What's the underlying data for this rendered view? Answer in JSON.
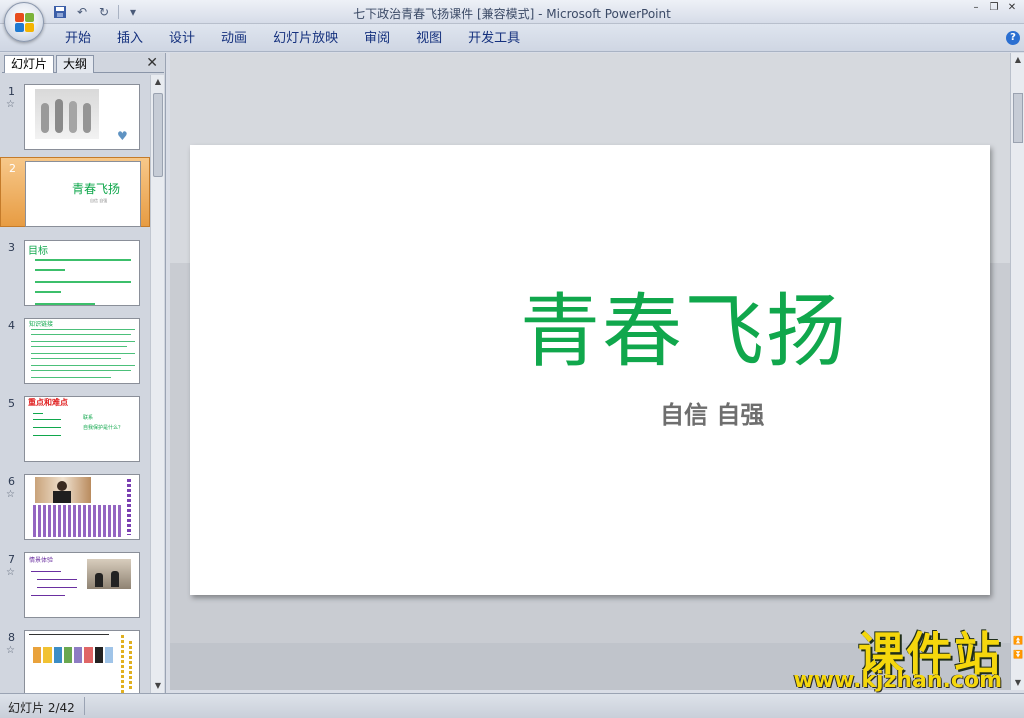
{
  "window": {
    "title": "七下政治青春飞扬课件 [兼容模式] - Microsoft PowerPoint"
  },
  "ribbon": {
    "tabs": [
      "开始",
      "插入",
      "设计",
      "动画",
      "幻灯片放映",
      "审阅",
      "视图",
      "开发工具"
    ]
  },
  "panel": {
    "tab_slides": "幻灯片",
    "tab_outline": "大纲",
    "close_glyph": "✕"
  },
  "thumbnails": [
    {
      "num": "1",
      "star": "☆"
    },
    {
      "num": "2",
      "title": "青春飞扬",
      "subtitle": "自信 自强"
    },
    {
      "num": "3",
      "title": "目标"
    },
    {
      "num": "4",
      "title": "知识链接"
    },
    {
      "num": "5",
      "title": "重点和难点",
      "lines": [
        "联系",
        "自我保护是什么？"
      ]
    },
    {
      "num": "6",
      "star": "☆"
    },
    {
      "num": "7",
      "star": "☆",
      "title": "情景体验"
    },
    {
      "num": "8",
      "star": "☆"
    }
  ],
  "slide": {
    "title": "青春飞扬",
    "subtitle": "自信 自强",
    "title_color": "#10a74c"
  },
  "status": {
    "slide_counter": "幻灯片 2/42"
  },
  "watermark": {
    "line1": "课件站",
    "line2": "www.kjzhan.com"
  },
  "icons": {
    "office_button": "office-logo-icon",
    "save": "save-icon",
    "undo": "undo-icon",
    "redo": "redo-icon",
    "help": "help-icon"
  }
}
